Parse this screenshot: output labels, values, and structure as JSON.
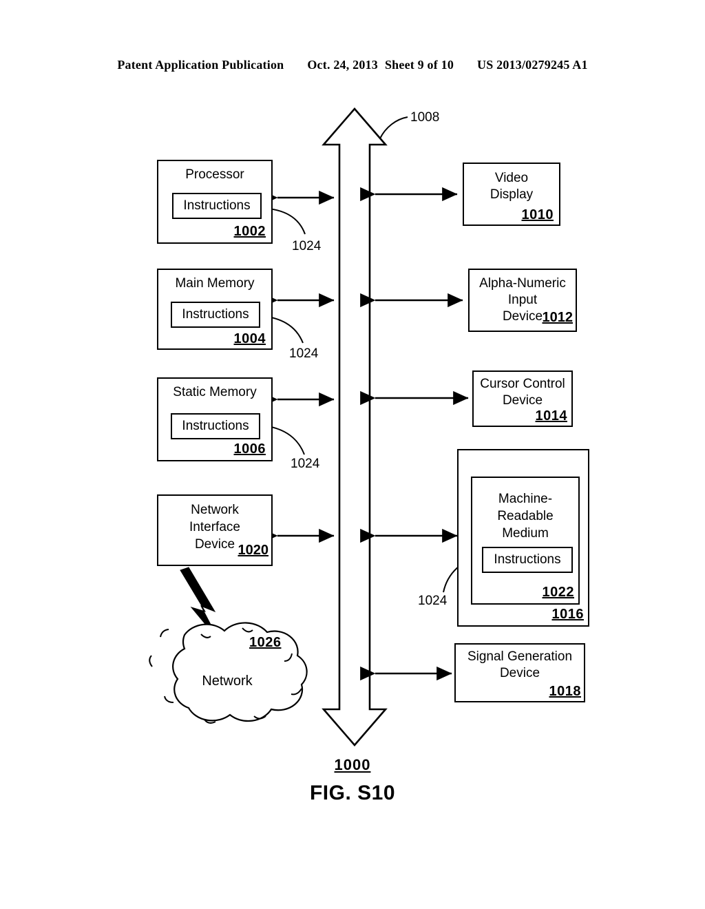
{
  "header": {
    "publication": "Patent Application Publication",
    "date": "Oct. 24, 2013",
    "sheet": "Sheet 9 of 10",
    "docnum": "US 2013/0279245 A1"
  },
  "figure": {
    "caption_number": "1000",
    "caption_label": "FIG. S10",
    "bus": {
      "name": "system-bus",
      "ref": "1008"
    },
    "left_blocks": [
      {
        "title": "Processor",
        "ref": "1002",
        "inner_label": "Instructions",
        "leader_ref": "1024"
      },
      {
        "title": "Main Memory",
        "ref": "1004",
        "inner_label": "Instructions",
        "leader_ref": "1024"
      },
      {
        "title": "Static Memory",
        "ref": "1006",
        "inner_label": "Instructions",
        "leader_ref": "1024"
      },
      {
        "title": "Network\nInterface\nDevice",
        "ref": "1020",
        "inner_label": "",
        "leader_ref": ""
      }
    ],
    "right_blocks": [
      {
        "title": "Video\nDisplay",
        "ref": "1010"
      },
      {
        "title": "Alpha-Numeric\nInput\nDevice",
        "ref": "1012"
      },
      {
        "title": "Cursor Control\nDevice",
        "ref": "1014"
      },
      {
        "title": "Signal Generation\nDevice",
        "ref": "1018"
      }
    ],
    "drive_unit": {
      "outer_ref": "1016",
      "medium_title": "Machine-\nReadable\nMedium",
      "medium_ref": "1022",
      "inner_label": "Instructions",
      "leader_ref": "1024"
    },
    "network": {
      "label": "Network",
      "ref": "1026"
    }
  },
  "colors": {
    "ink": "#000000",
    "paper": "#ffffff"
  }
}
